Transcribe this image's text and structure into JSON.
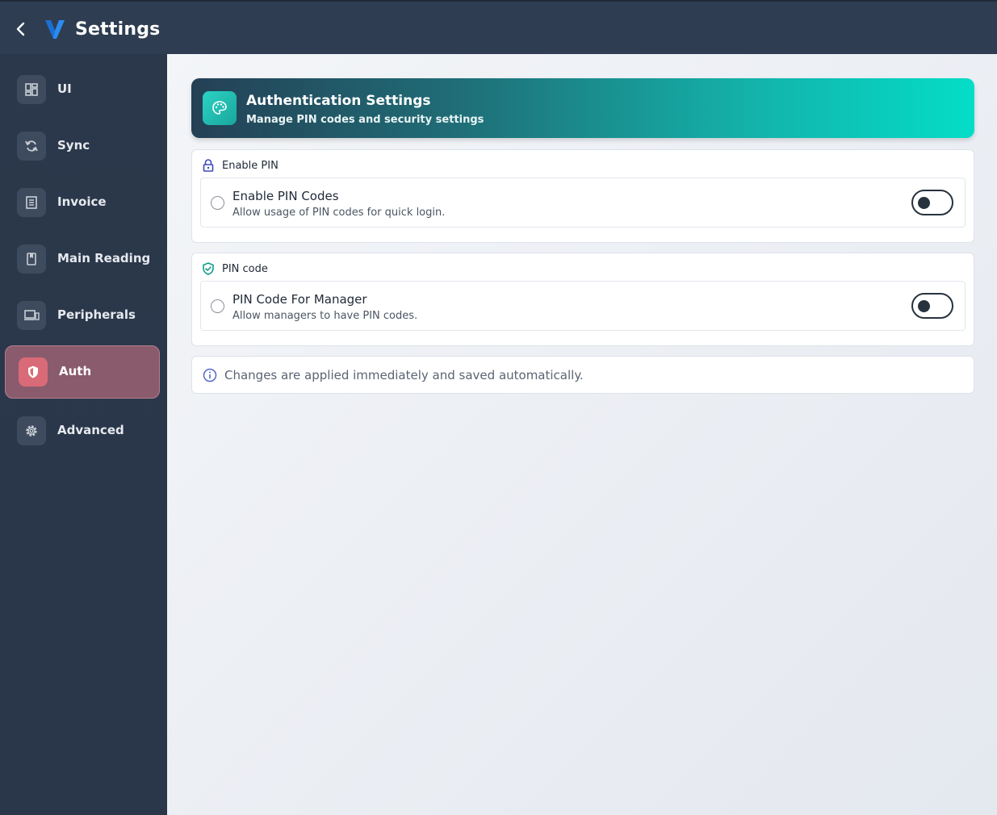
{
  "header": {
    "title": "Settings",
    "back_icon": "chevron-left-icon",
    "logo_icon": "v-logo-icon",
    "brand_color": "#2b8cf0"
  },
  "sidebar": {
    "items": [
      {
        "label": "UI",
        "icon": "dashboard-icon",
        "active": false
      },
      {
        "label": "Sync",
        "icon": "sync-icon",
        "active": false
      },
      {
        "label": "Invoice",
        "icon": "invoice-icon",
        "active": false
      },
      {
        "label": "Main Reading",
        "icon": "book-icon",
        "active": false
      },
      {
        "label": "Peripherals",
        "icon": "devices-icon",
        "active": false
      },
      {
        "label": "Auth",
        "icon": "shield-icon",
        "active": true
      },
      {
        "label": "Advanced",
        "icon": "gear-icon",
        "active": false
      }
    ]
  },
  "main": {
    "hero": {
      "title": "Authentication Settings",
      "subtitle": "Manage PIN codes and security settings",
      "icon": "palette-icon"
    },
    "sections": [
      {
        "heading": "Enable PIN",
        "heading_icon": "lock-icon",
        "setting": {
          "title": "Enable PIN Codes",
          "description": "Allow usage of PIN codes for quick login.",
          "enabled": false
        }
      },
      {
        "heading": "PIN code",
        "heading_icon": "shield-check-icon",
        "setting": {
          "title": "PIN Code For Manager",
          "description": "Allow managers to have PIN codes.",
          "enabled": false
        }
      }
    ],
    "info": {
      "icon": "info-icon",
      "text": "Changes are applied immediately and saved automatically."
    }
  },
  "colors": {
    "active_nav": "#8a5b6c",
    "active_icon": "#d96b78",
    "hero_start": "#244055",
    "hero_end": "#04ddc8",
    "lock_icon": "#3b4ab8",
    "shield_check_icon": "#0f9d8a",
    "info_icon": "#5566cc"
  }
}
